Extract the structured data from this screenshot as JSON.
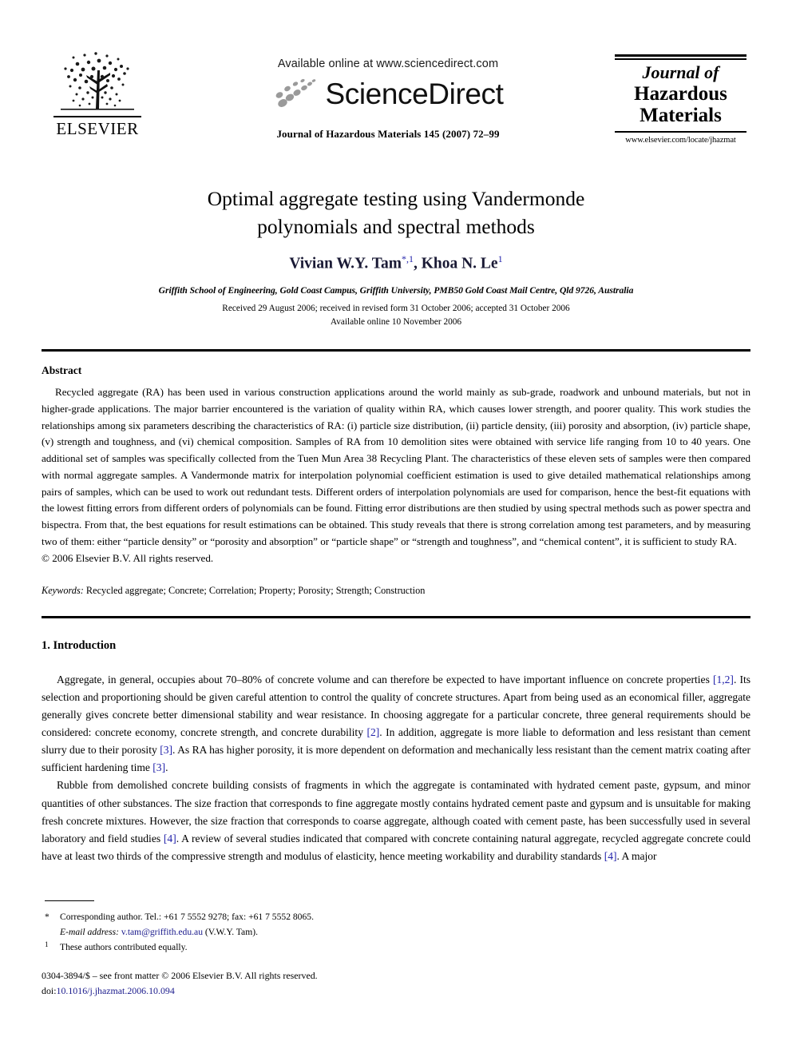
{
  "masthead": {
    "publisher_name": "ELSEVIER",
    "publisher_logo_icon": "elsevier-tree-icon",
    "available_online": "Available online at www.sciencedirect.com",
    "sciencedirect_wordmark": "ScienceDirect",
    "sciencedirect_swoosh_icon": "sciencedirect-swoosh-icon",
    "journal_citation_line": "Journal of Hazardous Materials 145 (2007) 72–99",
    "journal_logo": {
      "line1": "Journal of",
      "line2": "Hazardous",
      "line3": "Materials",
      "url": "www.elsevier.com/locate/jhazmat"
    }
  },
  "article": {
    "title_line1": "Optimal aggregate testing using Vandermonde",
    "title_line2": "polynomials and spectral methods",
    "authors": {
      "author1_name": "Vivian W.Y. Tam",
      "author1_marks": "*,1",
      "separator": ", ",
      "author2_name": "Khoa N. Le",
      "author2_marks": "1"
    },
    "affiliation": "Griffith School of Engineering, Gold Coast Campus, Griffith University, PMB50 Gold Coast Mail Centre, Qld 9726, Australia",
    "received_line": "Received 29 August 2006; received in revised form 31 October 2006; accepted 31 October 2006",
    "available_line": "Available online 10 November 2006"
  },
  "abstract": {
    "heading": "Abstract",
    "text": "Recycled aggregate (RA) has been used in various construction applications around the world mainly as sub-grade, roadwork and unbound materials, but not in higher-grade applications. The major barrier encountered is the variation of quality within RA, which causes lower strength, and poorer quality. This work studies the relationships among six parameters describing the characteristics of RA: (i) particle size distribution, (ii) particle density, (iii) porosity and absorption, (iv) particle shape, (v) strength and toughness, and (vi) chemical composition. Samples of RA from 10 demolition sites were obtained with service life ranging from 10 to 40 years. One additional set of samples was specifically collected from the Tuen Mun Area 38 Recycling Plant. The characteristics of these eleven sets of samples were then compared with normal aggregate samples. A Vandermonde matrix for interpolation polynomial coefficient estimation is used to give detailed mathematical relationships among pairs of samples, which can be used to work out redundant tests. Different orders of interpolation polynomials are used for comparison, hence the best-fit equations with the lowest fitting errors from different orders of polynomials can be found. Fitting error distributions are then studied by using spectral methods such as power spectra and bispectra. From that, the best equations for result estimations can be obtained. This study reveals that there is strong correlation among test parameters, and by measuring two of them: either “particle density” or “porosity and absorption” or “particle shape” or “strength and toughness”, and “chemical content”, it is sufficient to study RA.",
    "copyright": "© 2006 Elsevier B.V. All rights reserved.",
    "keywords_label": "Keywords:",
    "keywords_value": "Recycled aggregate; Concrete; Correlation; Property; Porosity; Strength; Construction"
  },
  "introduction": {
    "heading": "1. Introduction",
    "paragraph1_a": "Aggregate, in general, occupies about 70–80% of concrete volume and can therefore be expected to have important influence on concrete properties ",
    "paragraph1_cite1": "[1,2]",
    "paragraph1_b": ". Its selection and proportioning should be given careful attention to control the quality of concrete structures. Apart from being used as an economical filler, aggregate generally gives concrete better dimensional stability and wear resistance. In choosing aggregate for a particular concrete, three general requirements should be considered: concrete economy, concrete strength, and concrete durability ",
    "paragraph1_cite2": "[2]",
    "paragraph1_c": ". In addition, aggregate is more liable to deformation and less resistant than cement slurry due to their porosity ",
    "paragraph1_cite3": "[3]",
    "paragraph1_d": ". As RA has higher porosity, it is more dependent on deformation and mechanically less resistant than the cement matrix coating after sufficient hardening time ",
    "paragraph1_cite4": "[3]",
    "paragraph1_e": ".",
    "paragraph2_a": "Rubble from demolished concrete building consists of fragments in which the aggregate is contaminated with hydrated cement paste, gypsum, and minor quantities of other substances. The size fraction that corresponds to fine aggregate mostly contains hydrated cement paste and gypsum and is unsuitable for making fresh concrete mixtures. However, the size fraction that corresponds to coarse aggregate, although coated with cement paste, has been successfully used in several laboratory and field studies ",
    "paragraph2_cite1": "[4]",
    "paragraph2_b": ". A review of several studies indicated that compared with concrete containing natural aggregate, recycled aggregate concrete could have at least two thirds of the compressive strength and modulus of elasticity, hence meeting workability and durability standards ",
    "paragraph2_cite2": "[4]",
    "paragraph2_c": ". A major"
  },
  "footnotes": {
    "corresponding_marker": "*",
    "corresponding_text": "Corresponding author. Tel.: +61 7 5552 9278; fax: +61 7 5552 8065.",
    "email_label": "E-mail address:",
    "email_value": "v.tam@griffith.edu.au",
    "email_suffix": "(V.W.Y. Tam).",
    "equal_marker": "1",
    "equal_text": "These authors contributed equally."
  },
  "imprint": {
    "issn_line": "0304-3894/$ – see front matter © 2006 Elsevier B.V. All rights reserved.",
    "doi_label": "doi:",
    "doi_value": "10.1016/j.jhazmat.2006.10.094"
  },
  "colors": {
    "link_blue": "#1a1a8c",
    "cite_blue": "#2222aa",
    "text_black": "#000000",
    "swoosh_gray": "#9a9a9a"
  }
}
